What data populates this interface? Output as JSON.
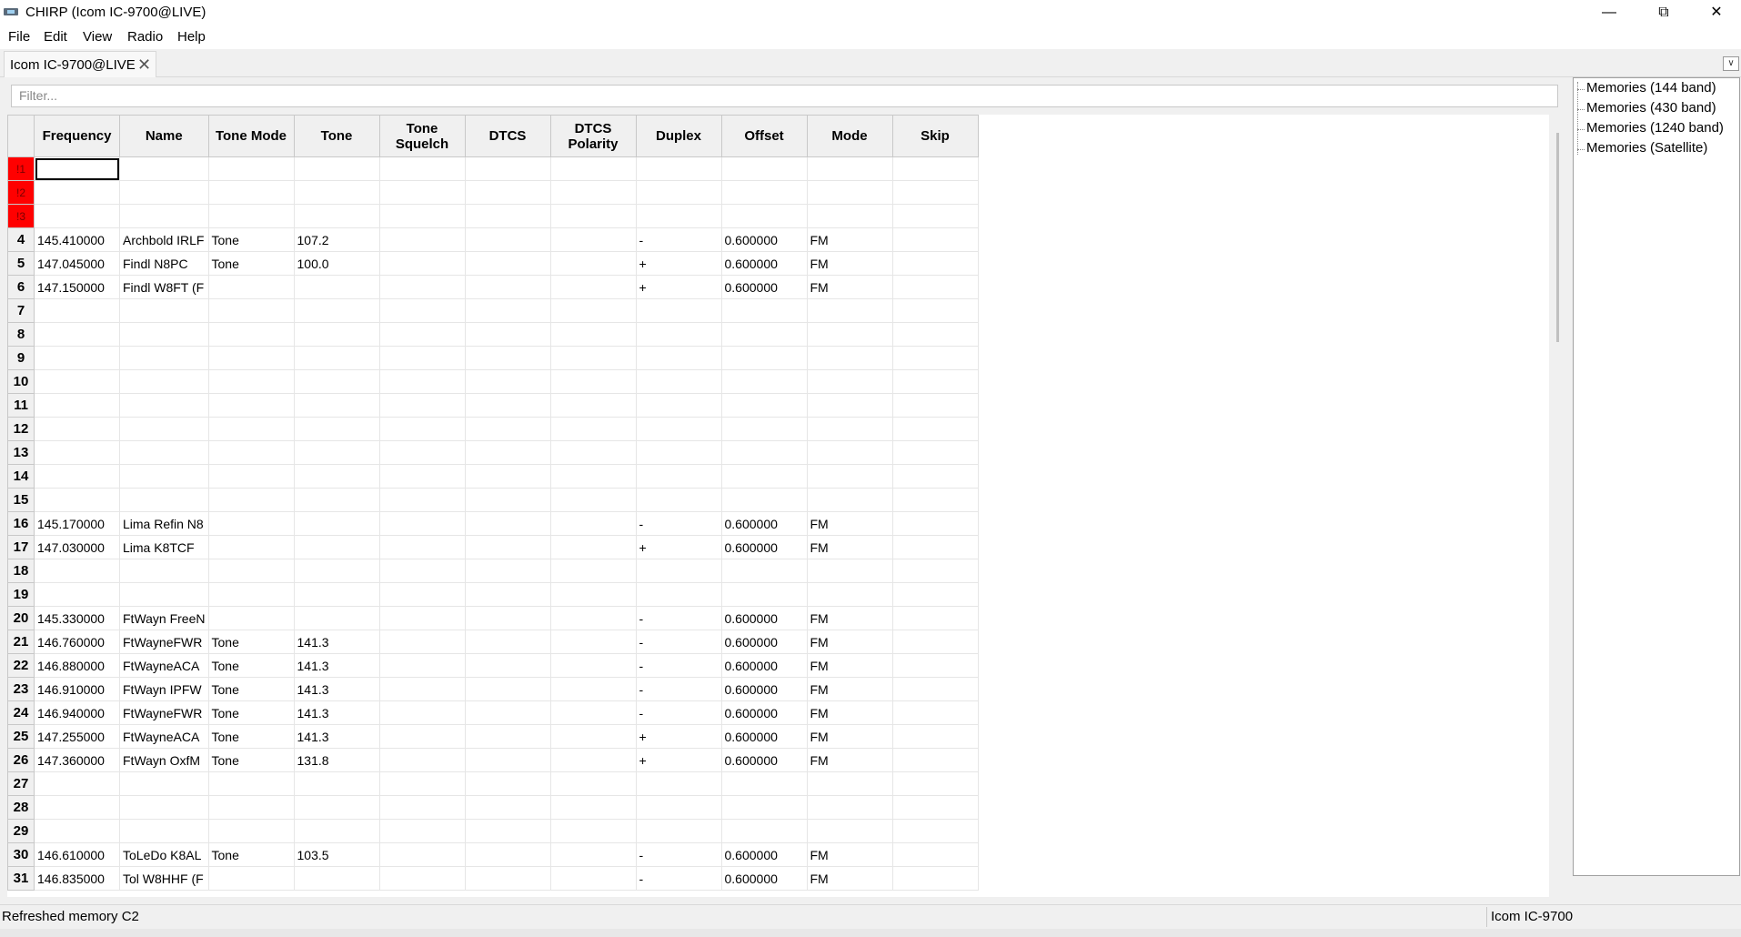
{
  "window": {
    "title": "CHIRP (Icom IC-9700@LIVE)",
    "minimize": "—",
    "maximize": "⧉",
    "close": "✕"
  },
  "menu": [
    "File",
    "Edit",
    "View",
    "Radio",
    "Help"
  ],
  "tab": {
    "label": "Icom IC-9700@LIVE",
    "close": "✕",
    "dropdown": "∨"
  },
  "filter": {
    "placeholder": "Filter..."
  },
  "columns": [
    "Frequency",
    "Name",
    "Tone Mode",
    "Tone",
    "Tone Squelch",
    "DTCS",
    "DTCS Polarity",
    "Duplex",
    "Offset",
    "Mode",
    "Skip"
  ],
  "rows": [
    {
      "num": "!1",
      "special": true,
      "cells": [
        "",
        "",
        "",
        "",
        "",
        "",
        "",
        "",
        "",
        "",
        ""
      ]
    },
    {
      "num": "!2",
      "special": true,
      "cells": [
        "",
        "",
        "",
        "",
        "",
        "",
        "",
        "",
        "",
        "",
        ""
      ]
    },
    {
      "num": "!3",
      "special": true,
      "cells": [
        "",
        "",
        "",
        "",
        "",
        "",
        "",
        "",
        "",
        "",
        ""
      ]
    },
    {
      "num": "4",
      "cells": [
        "145.410000",
        "Archbold IRLF",
        "Tone",
        "107.2",
        "",
        "",
        "",
        "-",
        "0.600000",
        "FM",
        ""
      ]
    },
    {
      "num": "5",
      "cells": [
        "147.045000",
        "Findl N8PC",
        "Tone",
        "100.0",
        "",
        "",
        "",
        "+",
        "0.600000",
        "FM",
        ""
      ]
    },
    {
      "num": "6",
      "cells": [
        "147.150000",
        "Findl W8FT (F",
        "",
        "",
        "",
        "",
        "",
        "+",
        "0.600000",
        "FM",
        ""
      ]
    },
    {
      "num": "7",
      "cells": [
        "",
        "",
        "",
        "",
        "",
        "",
        "",
        "",
        "",
        "",
        ""
      ]
    },
    {
      "num": "8",
      "cells": [
        "",
        "",
        "",
        "",
        "",
        "",
        "",
        "",
        "",
        "",
        ""
      ]
    },
    {
      "num": "9",
      "cells": [
        "",
        "",
        "",
        "",
        "",
        "",
        "",
        "",
        "",
        "",
        ""
      ]
    },
    {
      "num": "10",
      "cells": [
        "",
        "",
        "",
        "",
        "",
        "",
        "",
        "",
        "",
        "",
        ""
      ]
    },
    {
      "num": "11",
      "cells": [
        "",
        "",
        "",
        "",
        "",
        "",
        "",
        "",
        "",
        "",
        ""
      ]
    },
    {
      "num": "12",
      "cells": [
        "",
        "",
        "",
        "",
        "",
        "",
        "",
        "",
        "",
        "",
        ""
      ]
    },
    {
      "num": "13",
      "cells": [
        "",
        "",
        "",
        "",
        "",
        "",
        "",
        "",
        "",
        "",
        ""
      ]
    },
    {
      "num": "14",
      "cells": [
        "",
        "",
        "",
        "",
        "",
        "",
        "",
        "",
        "",
        "",
        ""
      ]
    },
    {
      "num": "15",
      "cells": [
        "",
        "",
        "",
        "",
        "",
        "",
        "",
        "",
        "",
        "",
        ""
      ]
    },
    {
      "num": "16",
      "cells": [
        "145.170000",
        "Lima Refin N8",
        "",
        "",
        "",
        "",
        "",
        "-",
        "0.600000",
        "FM",
        ""
      ]
    },
    {
      "num": "17",
      "cells": [
        "147.030000",
        "Lima K8TCF",
        "",
        "",
        "",
        "",
        "",
        "+",
        "0.600000",
        "FM",
        ""
      ]
    },
    {
      "num": "18",
      "cells": [
        "",
        "",
        "",
        "",
        "",
        "",
        "",
        "",
        "",
        "",
        ""
      ]
    },
    {
      "num": "19",
      "cells": [
        "",
        "",
        "",
        "",
        "",
        "",
        "",
        "",
        "",
        "",
        ""
      ]
    },
    {
      "num": "20",
      "cells": [
        "145.330000",
        "FtWayn FreeN",
        "",
        "",
        "",
        "",
        "",
        "-",
        "0.600000",
        "FM",
        ""
      ]
    },
    {
      "num": "21",
      "cells": [
        "146.760000",
        "FtWayneFWR",
        "Tone",
        "141.3",
        "",
        "",
        "",
        "-",
        "0.600000",
        "FM",
        ""
      ]
    },
    {
      "num": "22",
      "cells": [
        "146.880000",
        "FtWayneACA",
        "Tone",
        "141.3",
        "",
        "",
        "",
        "-",
        "0.600000",
        "FM",
        ""
      ]
    },
    {
      "num": "23",
      "cells": [
        "146.910000",
        "FtWayn IPFW",
        "Tone",
        "141.3",
        "",
        "",
        "",
        "-",
        "0.600000",
        "FM",
        ""
      ]
    },
    {
      "num": "24",
      "cells": [
        "146.940000",
        "FtWayneFWR",
        "Tone",
        "141.3",
        "",
        "",
        "",
        "-",
        "0.600000",
        "FM",
        ""
      ]
    },
    {
      "num": "25",
      "cells": [
        "147.255000",
        "FtWayneACA",
        "Tone",
        "141.3",
        "",
        "",
        "",
        "+",
        "0.600000",
        "FM",
        ""
      ]
    },
    {
      "num": "26",
      "cells": [
        "147.360000",
        "FtWayn OxfM",
        "Tone",
        "131.8",
        "",
        "",
        "",
        "+",
        "0.600000",
        "FM",
        ""
      ]
    },
    {
      "num": "27",
      "cells": [
        "",
        "",
        "",
        "",
        "",
        "",
        "",
        "",
        "",
        "",
        ""
      ]
    },
    {
      "num": "28",
      "cells": [
        "",
        "",
        "",
        "",
        "",
        "",
        "",
        "",
        "",
        "",
        ""
      ]
    },
    {
      "num": "29",
      "cells": [
        "",
        "",
        "",
        "",
        "",
        "",
        "",
        "",
        "",
        "",
        ""
      ]
    },
    {
      "num": "30",
      "cells": [
        "146.610000",
        "ToLeDo K8AL",
        "Tone",
        "103.5",
        "",
        "",
        "",
        "-",
        "0.600000",
        "FM",
        ""
      ]
    },
    {
      "num": "31",
      "cells": [
        "146.835000",
        "Tol W8HHF (F",
        "",
        "",
        "",
        "",
        "",
        "-",
        "0.600000",
        "FM",
        ""
      ]
    }
  ],
  "tree": [
    "Memories (144 band)",
    "Memories (430 band)",
    "Memories (1240 band)",
    "Memories (Satellite)"
  ],
  "status": {
    "message": "Refreshed memory C2",
    "radio": "Icom IC-9700"
  },
  "colors": {
    "special_row_header": "#ff0000"
  }
}
